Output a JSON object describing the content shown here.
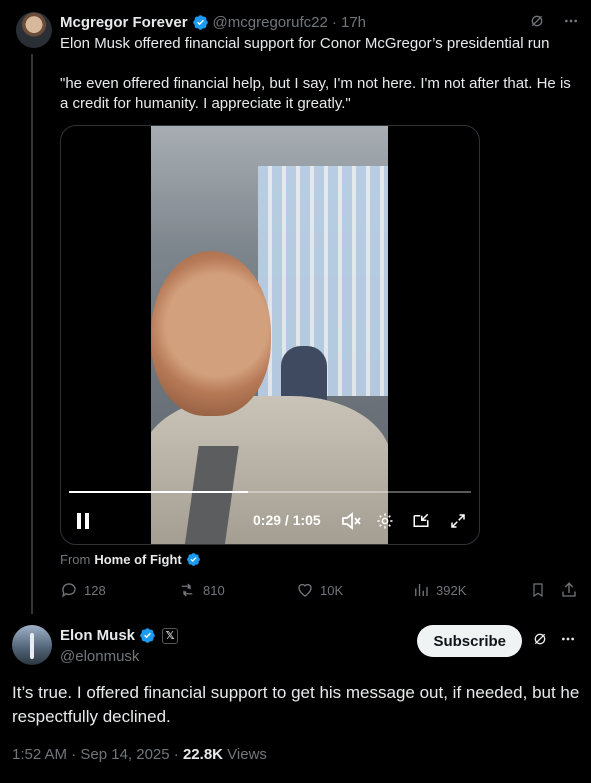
{
  "tweet1": {
    "name": "Mcgregor Forever",
    "handle": "@mcgregorufc22",
    "time": "· 17h",
    "text_line1": "Elon Musk offered financial support for Conor McGregor’s presidential run",
    "text_quote": "\"he even offered financial help, but I say, I'm not here. I'm not after that. He is a credit for humanity. I appreciate it greatly.\"",
    "video": {
      "current_time": "0:29",
      "duration": "1:05",
      "time_display": "0:29 / 1:05",
      "progress_fraction": 0.446
    },
    "from_label": "From",
    "from_source": "Home of Fight",
    "stats": {
      "replies": "128",
      "reposts": "810",
      "likes": "10K",
      "views": "392K"
    },
    "icons": [
      "grok-icon",
      "more-icon",
      "verified-icon",
      "pause-icon",
      "mute-icon",
      "settings-icon",
      "pip-icon",
      "fullscreen-icon",
      "reply-icon",
      "repost-icon",
      "like-icon",
      "views-icon",
      "bookmark-icon",
      "share-icon"
    ]
  },
  "tweet2": {
    "name": "Elon Musk",
    "handle": "@elonmusk",
    "badge": "𝕏",
    "subscribe_label": "Subscribe",
    "text": "It’s true. I offered financial support to get his message out, if needed, but he respectfully declined.",
    "timestamp": "1:52 AM · Sep 14, 2025",
    "sep": " · ",
    "views_count": "22.8K",
    "views_label": " Views"
  },
  "colors": {
    "background": "#000000",
    "text": "#e7e9ea",
    "muted": "#71767b",
    "verified": "#1d9bf0",
    "divider": "#2f3336"
  }
}
